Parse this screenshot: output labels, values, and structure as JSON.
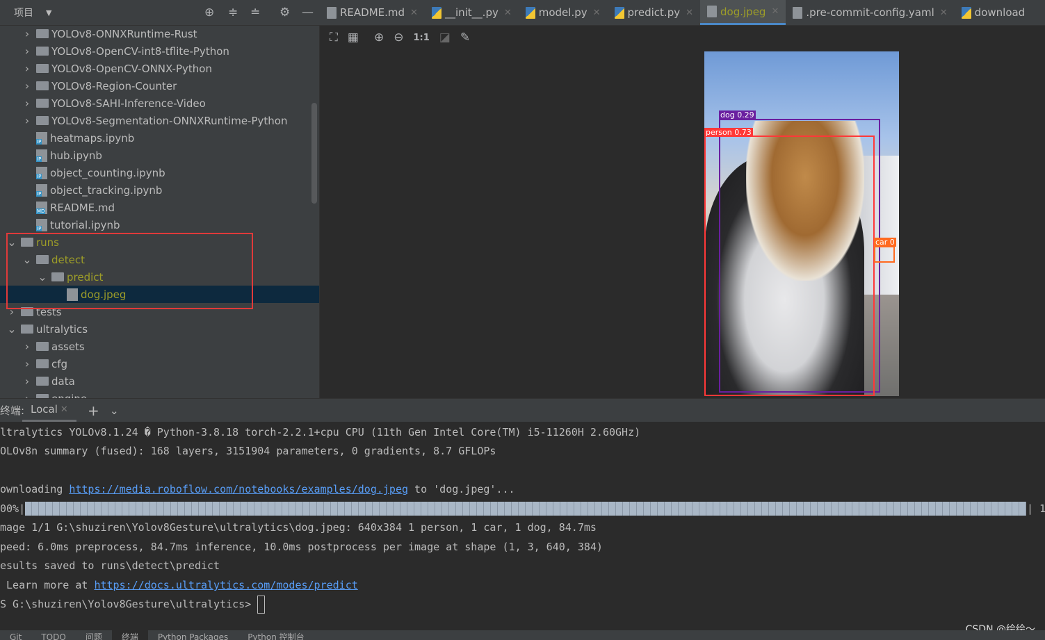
{
  "project": {
    "title": "项目",
    "icons": [
      "locate-icon",
      "expand-all-icon",
      "collapse-all-icon",
      "gear-icon",
      "minimize-icon"
    ]
  },
  "tree": [
    {
      "label": "YOLOv8-ONNXRuntime-Rust",
      "type": "folder",
      "indent": 1,
      "chev": ">"
    },
    {
      "label": "YOLOv8-OpenCV-int8-tflite-Python",
      "type": "folder",
      "indent": 1,
      "chev": ">"
    },
    {
      "label": "YOLOv8-OpenCV-ONNX-Python",
      "type": "folder",
      "indent": 1,
      "chev": ">"
    },
    {
      "label": "YOLOv8-Region-Counter",
      "type": "folder",
      "indent": 1,
      "chev": ">"
    },
    {
      "label": "YOLOv8-SAHI-Inference-Video",
      "type": "folder",
      "indent": 1,
      "chev": ">"
    },
    {
      "label": "YOLOv8-Segmentation-ONNXRuntime-Python",
      "type": "folder",
      "indent": 1,
      "chev": ">"
    },
    {
      "label": "heatmaps.ipynb",
      "type": "file",
      "badge": "IP",
      "indent": 1
    },
    {
      "label": "hub.ipynb",
      "type": "file",
      "badge": "IP",
      "indent": 1
    },
    {
      "label": "object_counting.ipynb",
      "type": "file",
      "badge": "IP",
      "indent": 1
    },
    {
      "label": "object_tracking.ipynb",
      "type": "file",
      "badge": "IP",
      "indent": 1
    },
    {
      "label": "README.md",
      "type": "file",
      "badge": "MD",
      "indent": 1
    },
    {
      "label": "tutorial.ipynb",
      "type": "file",
      "badge": "IP",
      "indent": 1
    },
    {
      "label": "runs",
      "type": "folder",
      "indent": 0,
      "chev": "v",
      "color": "yellow"
    },
    {
      "label": "detect",
      "type": "folder",
      "indent": 1,
      "chev": "v",
      "color": "yellow"
    },
    {
      "label": "predict",
      "type": "folder",
      "indent": 2,
      "chev": "v",
      "color": "yellow"
    },
    {
      "label": "dog.jpeg",
      "type": "file",
      "badge": "",
      "indent": 3,
      "color": "yellow",
      "selected": true
    },
    {
      "label": "tests",
      "type": "folder",
      "indent": 0,
      "chev": ">"
    },
    {
      "label": "ultralytics",
      "type": "folder",
      "indent": 0,
      "chev": "v"
    },
    {
      "label": "assets",
      "type": "folder",
      "indent": 1,
      "chev": ">"
    },
    {
      "label": "cfg",
      "type": "folder",
      "indent": 1,
      "chev": ">"
    },
    {
      "label": "data",
      "type": "folder",
      "indent": 1,
      "chev": ">"
    },
    {
      "label": "engine",
      "type": "folder",
      "indent": 1,
      "chev": ">"
    }
  ],
  "tabs": [
    {
      "label": "README.md",
      "icon": "markdown-file-icon"
    },
    {
      "label": "__init__.py",
      "icon": "python-file-icon"
    },
    {
      "label": "model.py",
      "icon": "python-file-icon"
    },
    {
      "label": "predict.py",
      "icon": "python-file-icon"
    },
    {
      "label": "dog.jpeg",
      "icon": "image-file-icon",
      "active": true
    },
    {
      "label": ".pre-commit-config.yaml",
      "icon": "yaml-file-icon"
    },
    {
      "label": "download",
      "icon": "python-file-icon"
    }
  ],
  "image_toolbar": {
    "icons": [
      "fit-icon",
      "grid-icon",
      "zoom-in-icon",
      "zoom-out-icon",
      "actual-size-icon",
      "background-icon",
      "color-picker-icon"
    ],
    "actual_size_label": "1:1"
  },
  "detections": [
    {
      "label": "dog 0.29",
      "color": "#6a1fa0"
    },
    {
      "label": "person 0.73",
      "color": "#ff3838"
    },
    {
      "label": "car 0",
      "color": "#ff6a1f"
    }
  ],
  "terminal": {
    "title": "终端:",
    "tab": "Local",
    "lines": [
      "ltralytics YOLOv8.1.24 � Python-3.8.18 torch-2.2.1+cpu CPU (11th Gen Intel Core(TM) i5-11260H 2.60GHz)",
      "OLOv8n summary (fused): 168 layers, 3151904 parameters, 0 gradients, 8.7 GFLOPs",
      "",
      "",
      "",
      "mage 1/1 G:\\shuziren\\Yolov8Gesture\\ultralytics\\dog.jpeg: 640x384 1 person, 1 car, 1 dog, 84.7ms",
      "peed: 6.0ms preprocess, 84.7ms inference, 10.0ms postprocess per image at shape (1, 3, 640, 384)",
      "esults saved to runs\\detect\\predict"
    ],
    "download_prefix": "ownloading ",
    "download_url": "https://media.roboflow.com/notebooks/examples/dog.jpeg",
    "download_suffix": " to 'dog.jpeg'...",
    "progress_label": "00%|",
    "progress_percent": 100,
    "progress_end": "| 1",
    "learn_prefix": " Learn more at ",
    "learn_url": "https://docs.ultralytics.com/modes/predict",
    "prompt": "S G:\\shuziren\\Yolov8Gesture\\ultralytics> "
  },
  "bottom_tabs": [
    "Git",
    "TODO",
    "问题",
    "终端",
    "Python Packages",
    "Python 控制台"
  ],
  "watermark": "CSDN @绘绘～"
}
